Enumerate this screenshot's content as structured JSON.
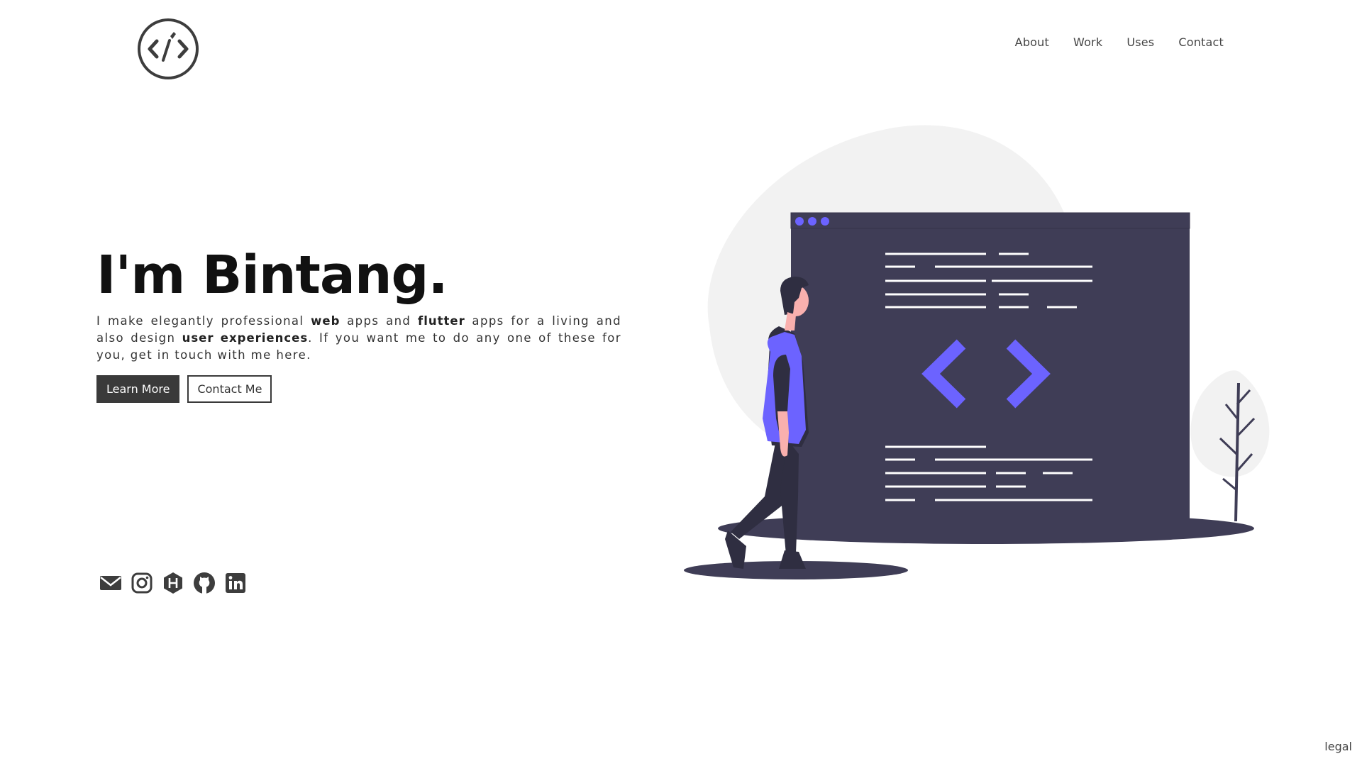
{
  "header": {
    "logo_icon": "code-brush-logo-icon",
    "nav": [
      {
        "label": "About"
      },
      {
        "label": "Work"
      },
      {
        "label": "Uses"
      },
      {
        "label": "Contact"
      }
    ]
  },
  "hero": {
    "title": "I'm Bintang.",
    "desc": {
      "p1": "I make elegantly professional ",
      "b1": "web",
      "p2": " apps and ",
      "b2": "flutter",
      "p3": " apps for a living and also design ",
      "b3": "user experiences",
      "p4": ". If you want me to do any one of these for you, get in touch with me here."
    },
    "buttons": {
      "learn_more": "Learn More",
      "contact_me": "Contact Me"
    }
  },
  "social": [
    "mail-icon",
    "instagram-icon",
    "hashnode-icon",
    "github-icon",
    "linkedin-icon"
  ],
  "footer": {
    "legal": "legal"
  },
  "colors": {
    "accent": "#6c63ff",
    "dark": "#3f3d56",
    "text": "#333333",
    "blob": "#f2f2f2"
  }
}
